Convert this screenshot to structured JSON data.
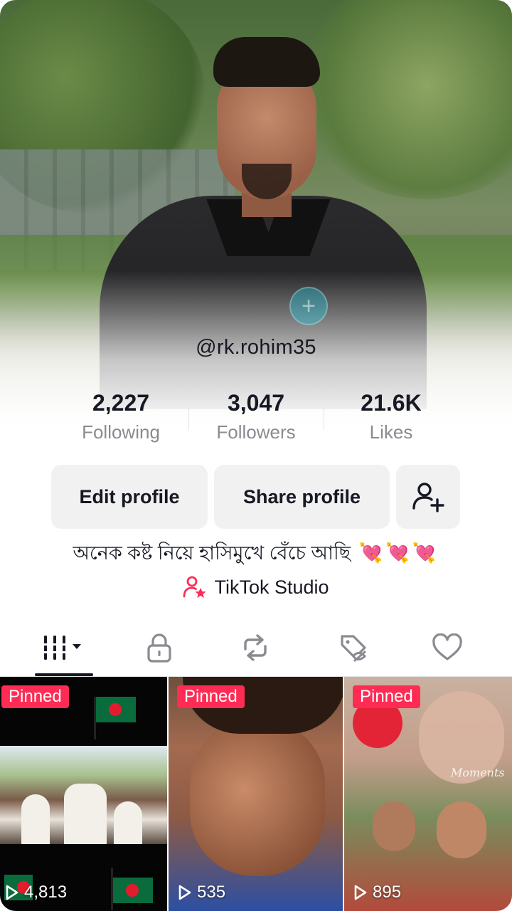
{
  "profile": {
    "username": "@rk.rohim35",
    "bio": "অনেক কষ্ট নিয়ে হাসিমুখে বেঁচে আছি",
    "bio_emoji": "💘💘💘"
  },
  "stats": [
    {
      "value": "2,227",
      "label": "Following"
    },
    {
      "value": "3,047",
      "label": "Followers"
    },
    {
      "value": "21.6K",
      "label": "Likes"
    }
  ],
  "buttons": {
    "edit": "Edit profile",
    "share": "Share profile",
    "add_friend_icon": "add-friend-icon"
  },
  "studio": {
    "label": "TikTok Studio",
    "icon": "creator-star-icon",
    "color": "#fe2c55"
  },
  "tabs": [
    {
      "icon": "videos-grid-icon",
      "active": true
    },
    {
      "icon": "lock-icon",
      "active": false
    },
    {
      "icon": "repost-icon",
      "active": false
    },
    {
      "icon": "hidden-tag-icon",
      "active": false
    },
    {
      "icon": "heart-icon",
      "active": false
    }
  ],
  "videos": [
    {
      "pinned": "Pinned",
      "views": "4,813"
    },
    {
      "pinned": "Pinned",
      "views": "535"
    },
    {
      "pinned": "Pinned",
      "views": "895"
    }
  ],
  "colors": {
    "accent": "#fe2c55",
    "text": "#161823",
    "secondary_text": "#8a8b91",
    "button_bg": "#f1f1f2"
  }
}
